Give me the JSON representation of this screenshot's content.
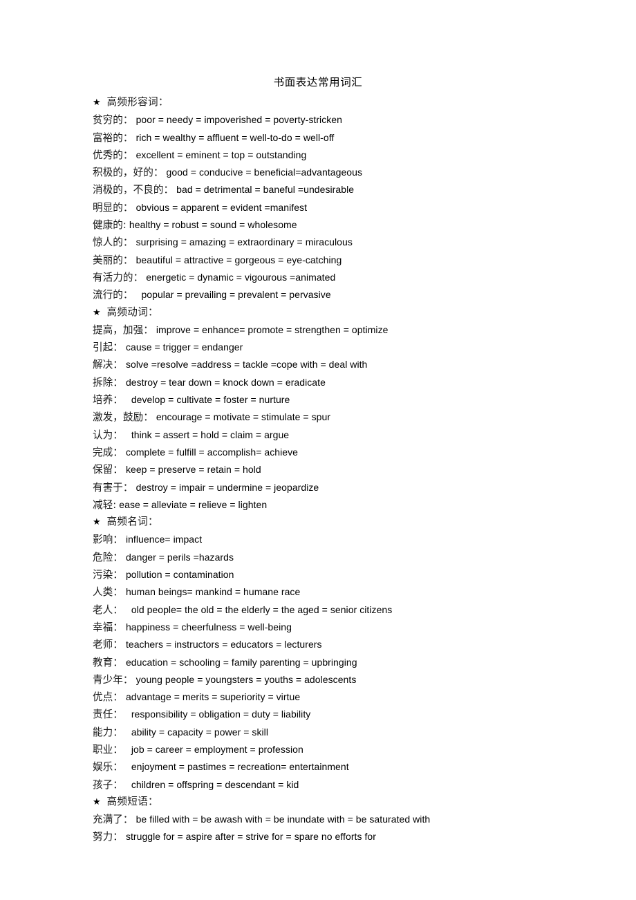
{
  "document": {
    "title": "书面表达常用词汇",
    "sections": [
      {
        "heading_bullet": "★",
        "heading_label": "高频形容词：",
        "entries": [
          {
            "term": "贫穷的：",
            "value": "poor = needy = impoverished = poverty-stricken"
          },
          {
            "term": "富裕的：",
            "value": "rich = wealthy = affluent = well-to-do = well-off"
          },
          {
            "term": "优秀的：",
            "value": "excellent = eminent = top = outstanding"
          },
          {
            "term": "积极的，好的：",
            "value": "good = conducive = beneficial=advantageous"
          },
          {
            "term": "消极的，不良的：",
            "value": "bad = detrimental = baneful =undesirable"
          },
          {
            "term": "明显的：",
            "value": "obvious = apparent = evident =manifest"
          },
          {
            "term": "健康的:",
            "value": "healthy = robust = sound = wholesome"
          },
          {
            "term": "惊人的：",
            "value": "surprising = amazing = extraordinary = miraculous"
          },
          {
            "term": "美丽的：",
            "value": "beautiful = attractive = gorgeous = eye-catching"
          },
          {
            "term": "有活力的：",
            "value": "energetic = dynamic = vigourous =animated"
          },
          {
            "term": "流行的：",
            "value": "  popular = prevailing = prevalent = pervasive"
          }
        ]
      },
      {
        "heading_bullet": "★",
        "heading_label": "高频动词：",
        "entries": [
          {
            "term": "提高，加强：",
            "value": "improve = enhance= promote = strengthen = optimize"
          },
          {
            "term": "引起：",
            "value": "cause = trigger = endanger"
          },
          {
            "term": "解决：",
            "value": "solve =resolve =address = tackle =cope with = deal with"
          },
          {
            "term": "拆除：",
            "value": "destroy = tear down = knock down = eradicate"
          },
          {
            "term": "培养：",
            "value": "  develop = cultivate = foster = nurture"
          },
          {
            "term": "激发，鼓励：",
            "value": "encourage = motivate = stimulate = spur"
          },
          {
            "term": "认为：",
            "value": "  think = assert = hold = claim = argue"
          },
          {
            "term": "完成：",
            "value": "complete = fulfill = accomplish= achieve"
          },
          {
            "term": "保留：",
            "value": "keep = preserve = retain = hold"
          },
          {
            "term": "有害于：",
            "value": "destroy = impair = undermine = jeopardize"
          },
          {
            "term": "减轻:",
            "value": "ease = alleviate = relieve = lighten"
          }
        ]
      },
      {
        "heading_bullet": "★",
        "heading_label": "高频名词：",
        "entries": [
          {
            "term": "影响：",
            "value": "influence= impact"
          },
          {
            "term": "危险：",
            "value": "danger = perils =hazards"
          },
          {
            "term": "污染：",
            "value": "pollution = contamination"
          },
          {
            "term": "人类：",
            "value": "human beings= mankind = humane race"
          },
          {
            "term": "老人：",
            "value": "  old people= the old = the elderly = the aged = senior citizens"
          },
          {
            "term": "幸福：",
            "value": "happiness = cheerfulness = well-being"
          },
          {
            "term": "老师：",
            "value": "teachers = instructors = educators = lecturers"
          },
          {
            "term": "教育：",
            "value": "education = schooling = family parenting = upbringing"
          },
          {
            "term": "青少年：",
            "value": "young people = youngsters = youths = adolescents"
          },
          {
            "term": "优点：",
            "value": "advantage = merits = superiority = virtue"
          },
          {
            "term": "责任：",
            "value": "  responsibility = obligation = duty = liability"
          },
          {
            "term": "能力：",
            "value": "  ability = capacity = power = skill"
          },
          {
            "term": "职业：",
            "value": "  job = career = employment = profession"
          },
          {
            "term": "娱乐：",
            "value": "  enjoyment = pastimes = recreation= entertainment"
          },
          {
            "term": "孩子：",
            "value": "  children = offspring = descendant = kid"
          }
        ]
      },
      {
        "heading_bullet": "★",
        "heading_label": "高频短语：",
        "entries": [
          {
            "term": "充满了：",
            "value": "be filled with = be awash with = be inundate with = be saturated with"
          },
          {
            "term": "努力：",
            "value": "struggle for = aspire after = strive for = spare no efforts for"
          }
        ]
      }
    ]
  }
}
